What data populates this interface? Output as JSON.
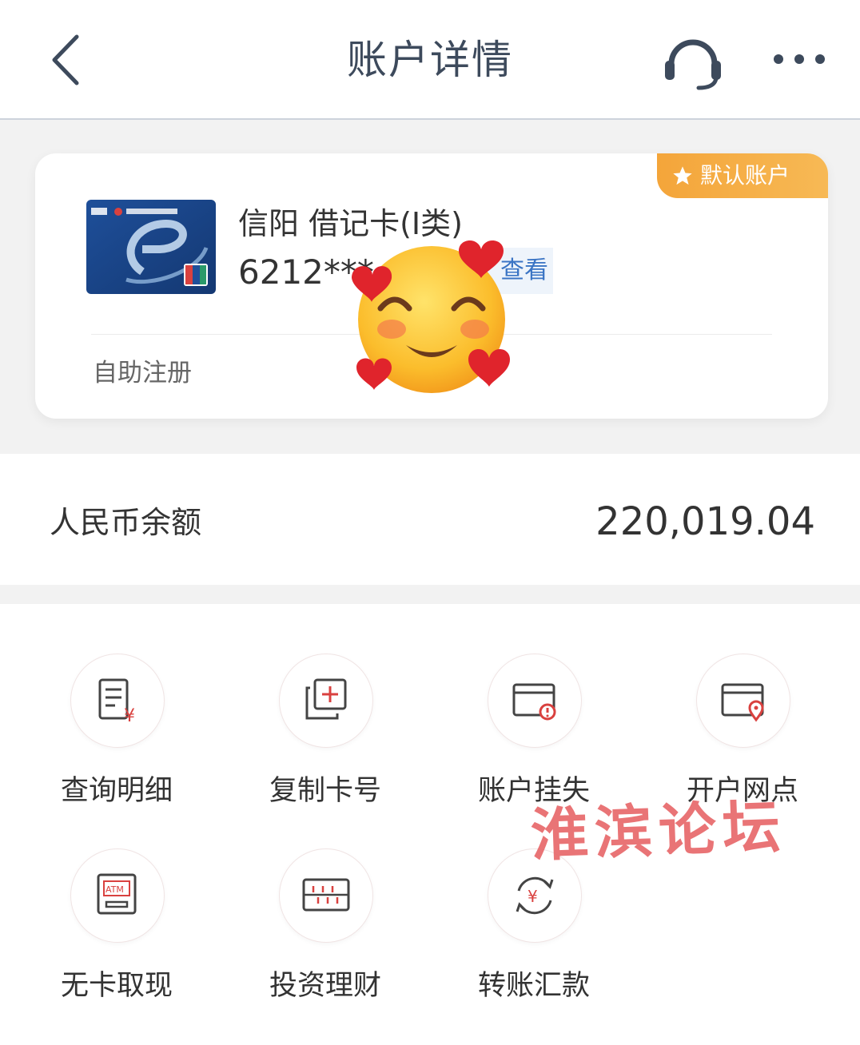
{
  "header": {
    "title": "账户详情",
    "back_icon": "chevron-left-icon",
    "service_icon": "headset-icon",
    "more_icon": "more-dots-icon"
  },
  "account_card": {
    "default_badge": "默认账户",
    "card_name": "信阳 借记卡(I类)",
    "card_number": "6212***",
    "view_label": "查看",
    "self_register": "自助注册",
    "accent_color": "#f5a940"
  },
  "balance": {
    "label": "人民币余额",
    "value": "220,019.04"
  },
  "functions": [
    {
      "label": "查询明细",
      "icon": "statement-icon"
    },
    {
      "label": "复制卡号",
      "icon": "copy-icon"
    },
    {
      "label": "账户挂失",
      "icon": "card-report-loss-icon"
    },
    {
      "label": "开户网点",
      "icon": "card-location-icon"
    },
    {
      "label": "无卡取现",
      "icon": "atm-icon"
    },
    {
      "label": "投资理财",
      "icon": "investment-icon"
    },
    {
      "label": "转账汇款",
      "icon": "transfer-icon"
    }
  ],
  "watermark": "淮滨论坛",
  "icon_color": "#d9413f"
}
